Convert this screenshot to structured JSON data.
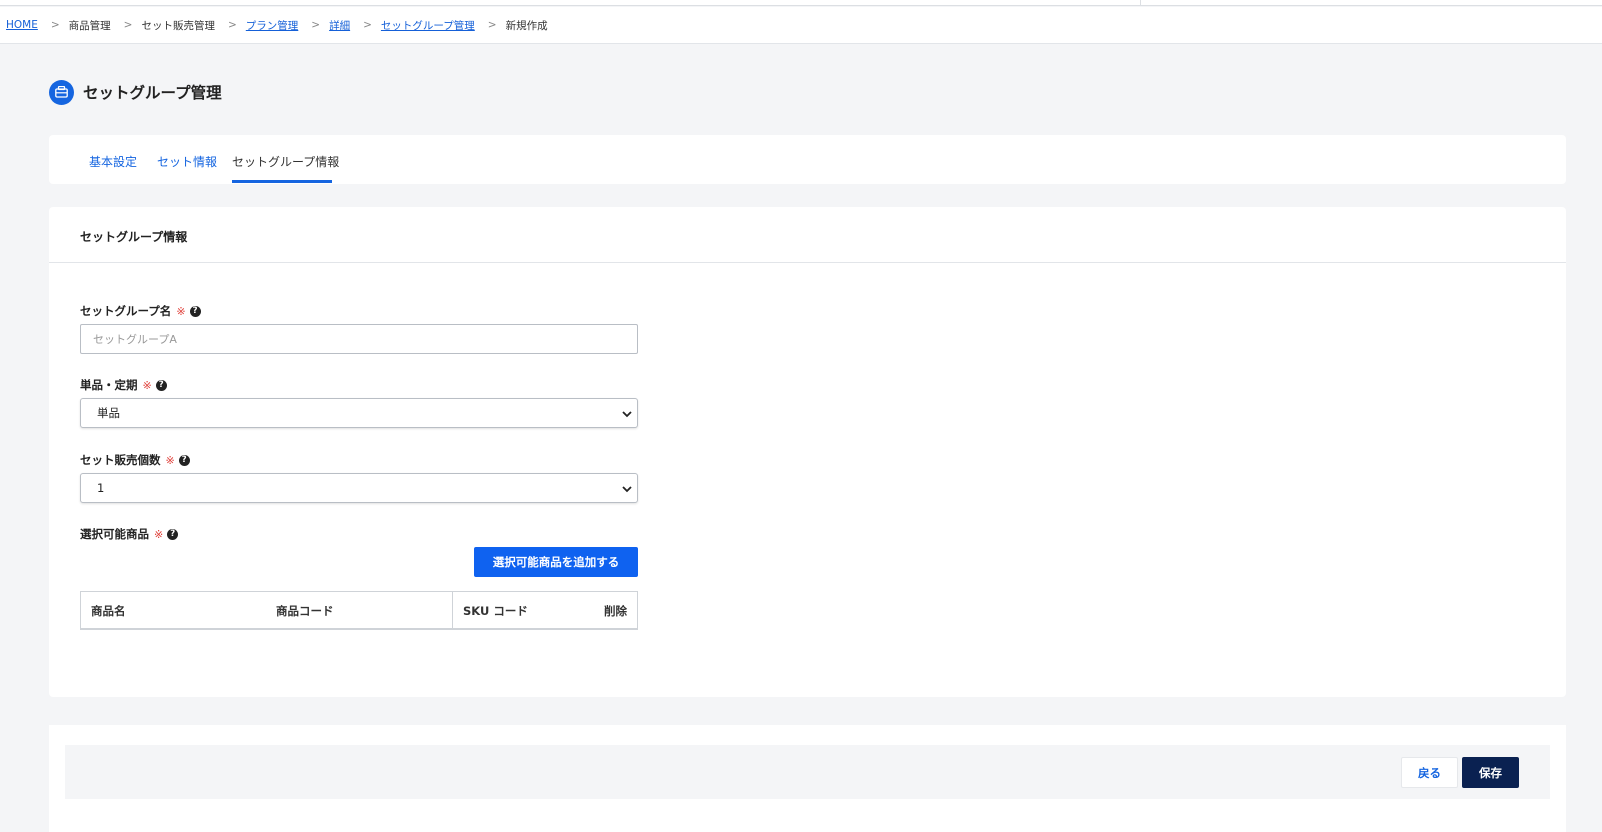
{
  "breadcrumb": [
    {
      "label": "HOME",
      "link": true
    },
    {
      "label": "商品管理",
      "link": false
    },
    {
      "label": "セット販売管理",
      "link": false
    },
    {
      "label": "プラン管理",
      "link": true
    },
    {
      "label": "詳細",
      "link": true
    },
    {
      "label": "セットグループ管理",
      "link": true
    },
    {
      "label": "新規作成",
      "link": false
    }
  ],
  "breadcrumb_separator": ">",
  "page": {
    "title": "セットグループ管理",
    "icon": "briefcase-icon"
  },
  "tabs": [
    {
      "label": "基本設定",
      "active": false
    },
    {
      "label": "セット情報",
      "active": false
    },
    {
      "label": "セットグループ情報",
      "active": true
    }
  ],
  "section": {
    "title": "セットグループ情報"
  },
  "fields": {
    "group_name": {
      "label": "セットグループ名",
      "required_mark": "※",
      "placeholder": "セットグループA",
      "value": ""
    },
    "type": {
      "label": "単品・定期",
      "required_mark": "※",
      "value": "単品"
    },
    "quantity": {
      "label": "セット販売個数",
      "required_mark": "※",
      "value": "1"
    },
    "products": {
      "label": "選択可能商品",
      "required_mark": "※",
      "add_button": "選択可能商品を追加する"
    }
  },
  "product_table": {
    "columns": [
      "商品名",
      "商品コード",
      "SKU コード",
      "削除"
    ],
    "rows": []
  },
  "footer": {
    "back_label": "戻る",
    "save_label": "保存"
  },
  "colors": {
    "primary": "#1565e0",
    "button_blue": "#0f62f0",
    "save_navy": "#0a2151",
    "required": "#e0403a"
  }
}
